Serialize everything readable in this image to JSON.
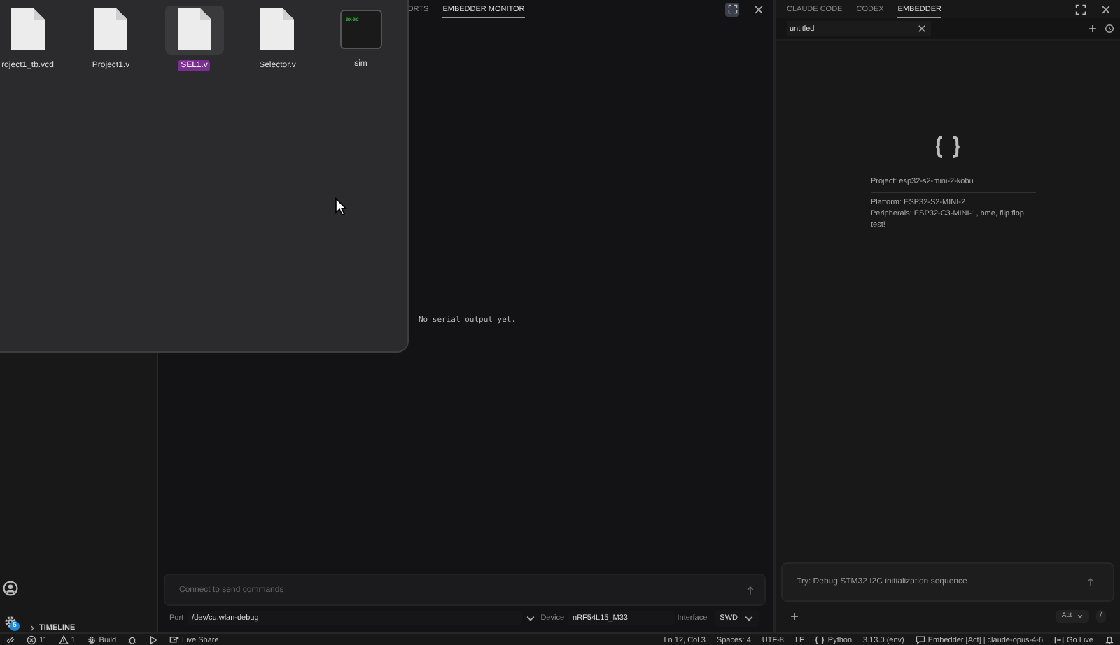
{
  "finder": {
    "files": [
      {
        "name": "roject1_tb.vcd",
        "kind": "document",
        "selected": false
      },
      {
        "name": "Project1.v",
        "kind": "document",
        "selected": false
      },
      {
        "name": "SEL1.v",
        "kind": "document",
        "selected": true
      },
      {
        "name": "Selector.v",
        "kind": "document",
        "selected": false
      },
      {
        "name": "sim",
        "kind": "executable",
        "badge": "exec",
        "selected": false
      }
    ]
  },
  "sidebar": {
    "notification_count": "5",
    "section": "TIMELINE"
  },
  "monitor": {
    "tabs": [
      {
        "label": "ORTS",
        "selected": false
      },
      {
        "label": "EMBEDDER MONITOR",
        "selected": true
      }
    ],
    "output": "No serial output yet.",
    "command_input": {
      "placeholder": "Connect to send commands"
    },
    "port": {
      "label": "Port",
      "value": "/dev/cu.wlan-debug"
    },
    "device": {
      "label": "Device",
      "value": "nRF54L15_M33"
    },
    "interface": {
      "label": "Interface",
      "value": "SWD"
    }
  },
  "assistant": {
    "tabs": [
      {
        "label": "CLAUDE CODE",
        "selected": false
      },
      {
        "label": "CODEX",
        "selected": false
      },
      {
        "label": "EMBEDDER",
        "selected": true
      }
    ],
    "session_tab": {
      "label": "untitled"
    },
    "project": "Project: esp32-s2-mini-2-kobu",
    "platform": "Platform: ESP32-S2-MINI-2",
    "peripherals": "Peripherals: ESP32-C3-MINI-1, bme, flip flop test!",
    "prompt": {
      "placeholder": "Try: Debug STM32 I2C initialization sequence"
    },
    "mode": "Act",
    "slash": "/"
  },
  "status_bar": {
    "left": [
      {
        "kind": "remote"
      },
      {
        "kind": "errors",
        "text": "11"
      },
      {
        "kind": "warnings",
        "text": "1"
      },
      {
        "kind": "build",
        "text": "Build"
      },
      {
        "kind": "debug"
      },
      {
        "kind": "run"
      },
      {
        "kind": "live_share",
        "text": "Live Share"
      }
    ],
    "right": [
      {
        "kind": "text",
        "text": "Ln 12, Col 3"
      },
      {
        "kind": "text",
        "text": "Spaces: 4"
      },
      {
        "kind": "text",
        "text": "UTF-8"
      },
      {
        "kind": "text",
        "text": "LF"
      },
      {
        "kind": "language",
        "text": "Python"
      },
      {
        "kind": "text",
        "text": "3.13.0 (env)"
      },
      {
        "kind": "chat",
        "text": "Embedder [Act] | claude-opus-4-6"
      },
      {
        "kind": "go_live",
        "text": "Go Live"
      },
      {
        "kind": "bell"
      }
    ]
  }
}
